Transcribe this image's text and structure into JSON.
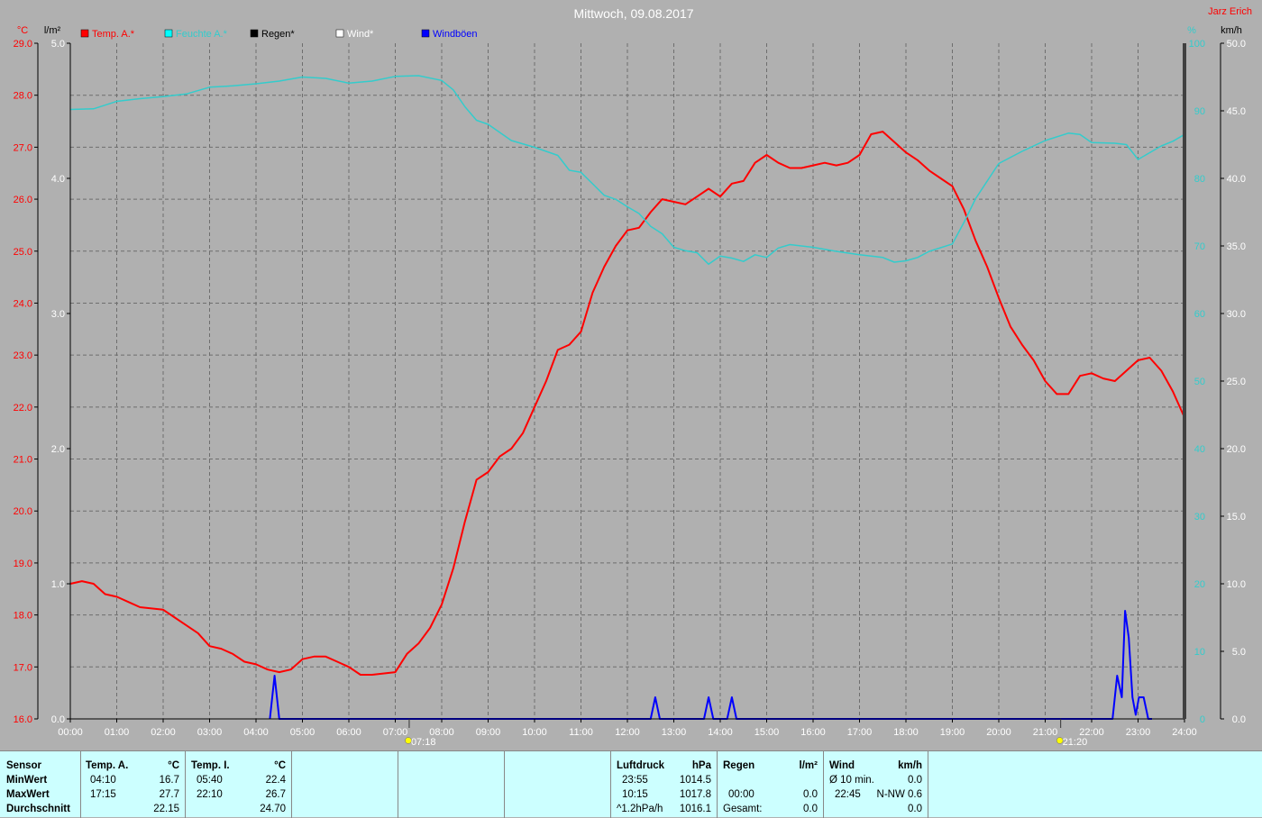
{
  "header": {
    "title": "Mittwoch, 09.08.2017",
    "author": "Jarz Erich"
  },
  "legend": [
    {
      "label": "Temp. A.*",
      "color": "#ff0000"
    },
    {
      "label": "Feuchte A.*",
      "color": "#00ffff"
    },
    {
      "label": "Regen*",
      "color": "#000000"
    },
    {
      "label": "Wind*",
      "color": "#ffffff"
    },
    {
      "label": "Windböen",
      "color": "#0000ff"
    }
  ],
  "units": {
    "temp": "°C",
    "rain": "l/m²",
    "humidity": "%",
    "wind": "km/h"
  },
  "sun": {
    "sunrise": "07:18",
    "sunset": "21:20"
  },
  "colors": {
    "temp": "#ff0000",
    "humidity": "#33cccc",
    "gusts": "#0000ff",
    "plot_bg": "#b0b0b0",
    "panel_bg": "#ccffff"
  },
  "chart_data": {
    "type": "line",
    "x_unit": "hours",
    "xlim": [
      0,
      24
    ],
    "x_ticks": [
      "00:00",
      "01:00",
      "02:00",
      "03:00",
      "04:00",
      "05:00",
      "06:00",
      "07:00",
      "08:00",
      "09:00",
      "10:00",
      "11:00",
      "12:00",
      "13:00",
      "14:00",
      "15:00",
      "16:00",
      "17:00",
      "18:00",
      "19:00",
      "20:00",
      "21:00",
      "22:00",
      "23:00",
      "24:00"
    ],
    "axes": {
      "temp": {
        "ylim": [
          16,
          29
        ],
        "ticks": [
          "16.0",
          "17.0",
          "18.0",
          "19.0",
          "20.0",
          "21.0",
          "22.0",
          "23.0",
          "24.0",
          "25.0",
          "26.0",
          "27.0",
          "28.0",
          "29.0"
        ]
      },
      "rain": {
        "ylim": [
          0,
          5
        ],
        "ticks": [
          "0.0",
          "1.0",
          "2.0",
          "3.0",
          "4.0",
          "5.0"
        ]
      },
      "humidity": {
        "ylim": [
          0,
          100
        ],
        "ticks": [
          "0",
          "10",
          "20",
          "30",
          "40",
          "50",
          "60",
          "70",
          "80",
          "90",
          "100"
        ]
      },
      "wind": {
        "ylim": [
          0,
          50
        ],
        "ticks": [
          "0.0",
          "5.0",
          "10.0",
          "15.0",
          "20.0",
          "25.0",
          "30.0",
          "35.0",
          "40.0",
          "45.0",
          "50.0"
        ]
      }
    },
    "series": [
      {
        "name": "Temp. A.*",
        "axis": "temp",
        "points": [
          [
            0,
            18.6
          ],
          [
            0.25,
            18.65
          ],
          [
            0.5,
            18.6
          ],
          [
            0.75,
            18.4
          ],
          [
            1,
            18.35
          ],
          [
            1.25,
            18.25
          ],
          [
            1.5,
            18.15
          ],
          [
            2,
            18.1
          ],
          [
            2.25,
            17.95
          ],
          [
            2.5,
            17.8
          ],
          [
            2.75,
            17.65
          ],
          [
            3,
            17.4
          ],
          [
            3.25,
            17.35
          ],
          [
            3.5,
            17.25
          ],
          [
            3.75,
            17.1
          ],
          [
            4,
            17.05
          ],
          [
            4.25,
            16.95
          ],
          [
            4.5,
            16.9
          ],
          [
            4.75,
            16.95
          ],
          [
            5,
            17.15
          ],
          [
            5.25,
            17.2
          ],
          [
            5.5,
            17.2
          ],
          [
            5.75,
            17.1
          ],
          [
            6,
            17.0
          ],
          [
            6.25,
            16.85
          ],
          [
            6.5,
            16.85
          ],
          [
            7,
            16.9
          ],
          [
            7.25,
            17.25
          ],
          [
            7.5,
            17.45
          ],
          [
            7.75,
            17.75
          ],
          [
            8,
            18.2
          ],
          [
            8.25,
            18.9
          ],
          [
            8.5,
            19.8
          ],
          [
            8.75,
            20.6
          ],
          [
            9,
            20.75
          ],
          [
            9.25,
            21.05
          ],
          [
            9.5,
            21.2
          ],
          [
            9.75,
            21.5
          ],
          [
            10,
            22.0
          ],
          [
            10.25,
            22.5
          ],
          [
            10.5,
            23.1
          ],
          [
            10.75,
            23.2
          ],
          [
            11,
            23.45
          ],
          [
            11.25,
            24.2
          ],
          [
            11.5,
            24.7
          ],
          [
            11.75,
            25.1
          ],
          [
            12,
            25.4
          ],
          [
            12.25,
            25.45
          ],
          [
            12.5,
            25.75
          ],
          [
            12.75,
            26.0
          ],
          [
            13,
            25.95
          ],
          [
            13.25,
            25.9
          ],
          [
            13.5,
            26.05
          ],
          [
            13.75,
            26.2
          ],
          [
            14,
            26.05
          ],
          [
            14.25,
            26.3
          ],
          [
            14.5,
            26.35
          ],
          [
            14.75,
            26.7
          ],
          [
            15,
            26.85
          ],
          [
            15.25,
            26.7
          ],
          [
            15.5,
            26.6
          ],
          [
            15.75,
            26.6
          ],
          [
            16,
            26.65
          ],
          [
            16.25,
            26.7
          ],
          [
            16.5,
            26.65
          ],
          [
            16.75,
            26.7
          ],
          [
            17,
            26.85
          ],
          [
            17.25,
            27.25
          ],
          [
            17.5,
            27.3
          ],
          [
            17.75,
            27.1
          ],
          [
            18,
            26.9
          ],
          [
            18.25,
            26.75
          ],
          [
            18.5,
            26.55
          ],
          [
            18.75,
            26.4
          ],
          [
            19,
            26.25
          ],
          [
            19.25,
            25.8
          ],
          [
            19.5,
            25.2
          ],
          [
            19.75,
            24.7
          ],
          [
            20,
            24.1
          ],
          [
            20.25,
            23.55
          ],
          [
            20.5,
            23.2
          ],
          [
            20.75,
            22.9
          ],
          [
            21,
            22.5
          ],
          [
            21.25,
            22.25
          ],
          [
            21.5,
            22.25
          ],
          [
            21.75,
            22.6
          ],
          [
            22,
            22.65
          ],
          [
            22.25,
            22.55
          ],
          [
            22.5,
            22.5
          ],
          [
            22.75,
            22.7
          ],
          [
            23,
            22.9
          ],
          [
            23.25,
            22.95
          ],
          [
            23.5,
            22.7
          ],
          [
            23.75,
            22.3
          ],
          [
            24,
            21.8
          ]
        ]
      },
      {
        "name": "Feuchte A.*",
        "axis": "humidity",
        "points": [
          [
            0,
            90.2
          ],
          [
            0.5,
            90.3
          ],
          [
            1,
            91.4
          ],
          [
            1.5,
            91.8
          ],
          [
            2,
            92.1
          ],
          [
            2.5,
            92.5
          ],
          [
            3,
            93.5
          ],
          [
            3.5,
            93.7
          ],
          [
            4,
            94.0
          ],
          [
            4.5,
            94.4
          ],
          [
            5,
            95.0
          ],
          [
            5.5,
            94.8
          ],
          [
            6,
            94.1
          ],
          [
            6.5,
            94.4
          ],
          [
            7,
            95.1
          ],
          [
            7.5,
            95.2
          ],
          [
            8,
            94.5
          ],
          [
            8.25,
            93.1
          ],
          [
            8.5,
            90.6
          ],
          [
            8.75,
            88.6
          ],
          [
            9,
            88.0
          ],
          [
            9.5,
            85.6
          ],
          [
            10,
            84.6
          ],
          [
            10.5,
            83.4
          ],
          [
            10.75,
            81.2
          ],
          [
            11,
            80.9
          ],
          [
            11.25,
            79.2
          ],
          [
            11.5,
            77.5
          ],
          [
            11.75,
            76.9
          ],
          [
            12,
            75.8
          ],
          [
            12.25,
            74.8
          ],
          [
            12.5,
            72.9
          ],
          [
            12.75,
            71.8
          ],
          [
            13,
            69.8
          ],
          [
            13.25,
            69.3
          ],
          [
            13.5,
            69.0
          ],
          [
            13.75,
            67.3
          ],
          [
            14,
            68.5
          ],
          [
            14.25,
            68.2
          ],
          [
            14.5,
            67.7
          ],
          [
            14.75,
            68.7
          ],
          [
            15,
            68.3
          ],
          [
            15.25,
            69.7
          ],
          [
            15.5,
            70.2
          ],
          [
            16,
            69.8
          ],
          [
            16.5,
            69.2
          ],
          [
            17,
            68.7
          ],
          [
            17.5,
            68.3
          ],
          [
            17.75,
            67.6
          ],
          [
            18,
            67.8
          ],
          [
            18.25,
            68.3
          ],
          [
            18.5,
            69.2
          ],
          [
            19,
            70.3
          ],
          [
            19.25,
            73.5
          ],
          [
            19.5,
            77.0
          ],
          [
            20,
            82.2
          ],
          [
            20.5,
            84.0
          ],
          [
            21,
            85.6
          ],
          [
            21.5,
            86.7
          ],
          [
            21.75,
            86.5
          ],
          [
            22,
            85.3
          ],
          [
            22.5,
            85.2
          ],
          [
            22.75,
            85.0
          ],
          [
            23,
            82.8
          ],
          [
            23.25,
            83.8
          ],
          [
            23.5,
            84.8
          ],
          [
            23.75,
            85.5
          ],
          [
            24,
            86.5
          ]
        ]
      },
      {
        "name": "Windböen",
        "axis": "wind",
        "points": [
          [
            4.3,
            0
          ],
          [
            4.4,
            3.2
          ],
          [
            4.5,
            0
          ],
          [
            12.5,
            0
          ],
          [
            12.6,
            1.6
          ],
          [
            12.7,
            0
          ],
          [
            13.65,
            0
          ],
          [
            13.75,
            1.6
          ],
          [
            13.85,
            0
          ],
          [
            14.15,
            0
          ],
          [
            14.25,
            1.6
          ],
          [
            14.35,
            0
          ],
          [
            22.45,
            0
          ],
          [
            22.55,
            3.2
          ],
          [
            22.65,
            1.6
          ],
          [
            22.72,
            8.0
          ],
          [
            22.8,
            6.0
          ],
          [
            22.88,
            1.6
          ],
          [
            22.95,
            0.3
          ],
          [
            23.02,
            1.6
          ],
          [
            23.12,
            1.6
          ],
          [
            23.22,
            0
          ],
          [
            23.3,
            0
          ]
        ]
      }
    ]
  },
  "stats": {
    "rows": [
      "Sensor",
      "MinWert",
      "MaxWert",
      "Durchschnitt"
    ],
    "temp_a": {
      "title": "Temp. A.",
      "unit": "°C",
      "min_time": "04:10",
      "min": "16.7",
      "max_time": "17:15",
      "max": "27.7",
      "avg": "22.15"
    },
    "temp_i": {
      "title": "Temp. I.",
      "unit": "°C",
      "min_time": "05:40",
      "min": "22.4",
      "max_time": "22:10",
      "max": "26.7",
      "avg": "24.70"
    },
    "pressure": {
      "title": "Luftdruck",
      "unit": "hPa",
      "min_time": "23:55",
      "min": "1014.5",
      "max_time": "10:15",
      "max": "1017.8",
      "trend": "^1.2hPa/h",
      "trend_value": "1016.1"
    },
    "rain": {
      "title": "Regen",
      "unit": "l/m²",
      "r1_label": "00:00",
      "r1_value": "0.0",
      "r2_label": "Gesamt:",
      "r2_value": "0.0"
    },
    "wind": {
      "title": "Wind",
      "unit": "km/h",
      "avg_label": "Ø 10 min.",
      "avg_value": "0.0",
      "max_time": "22:45",
      "max_value": "N-NW 0.6",
      "last_value": "0.0"
    }
  }
}
